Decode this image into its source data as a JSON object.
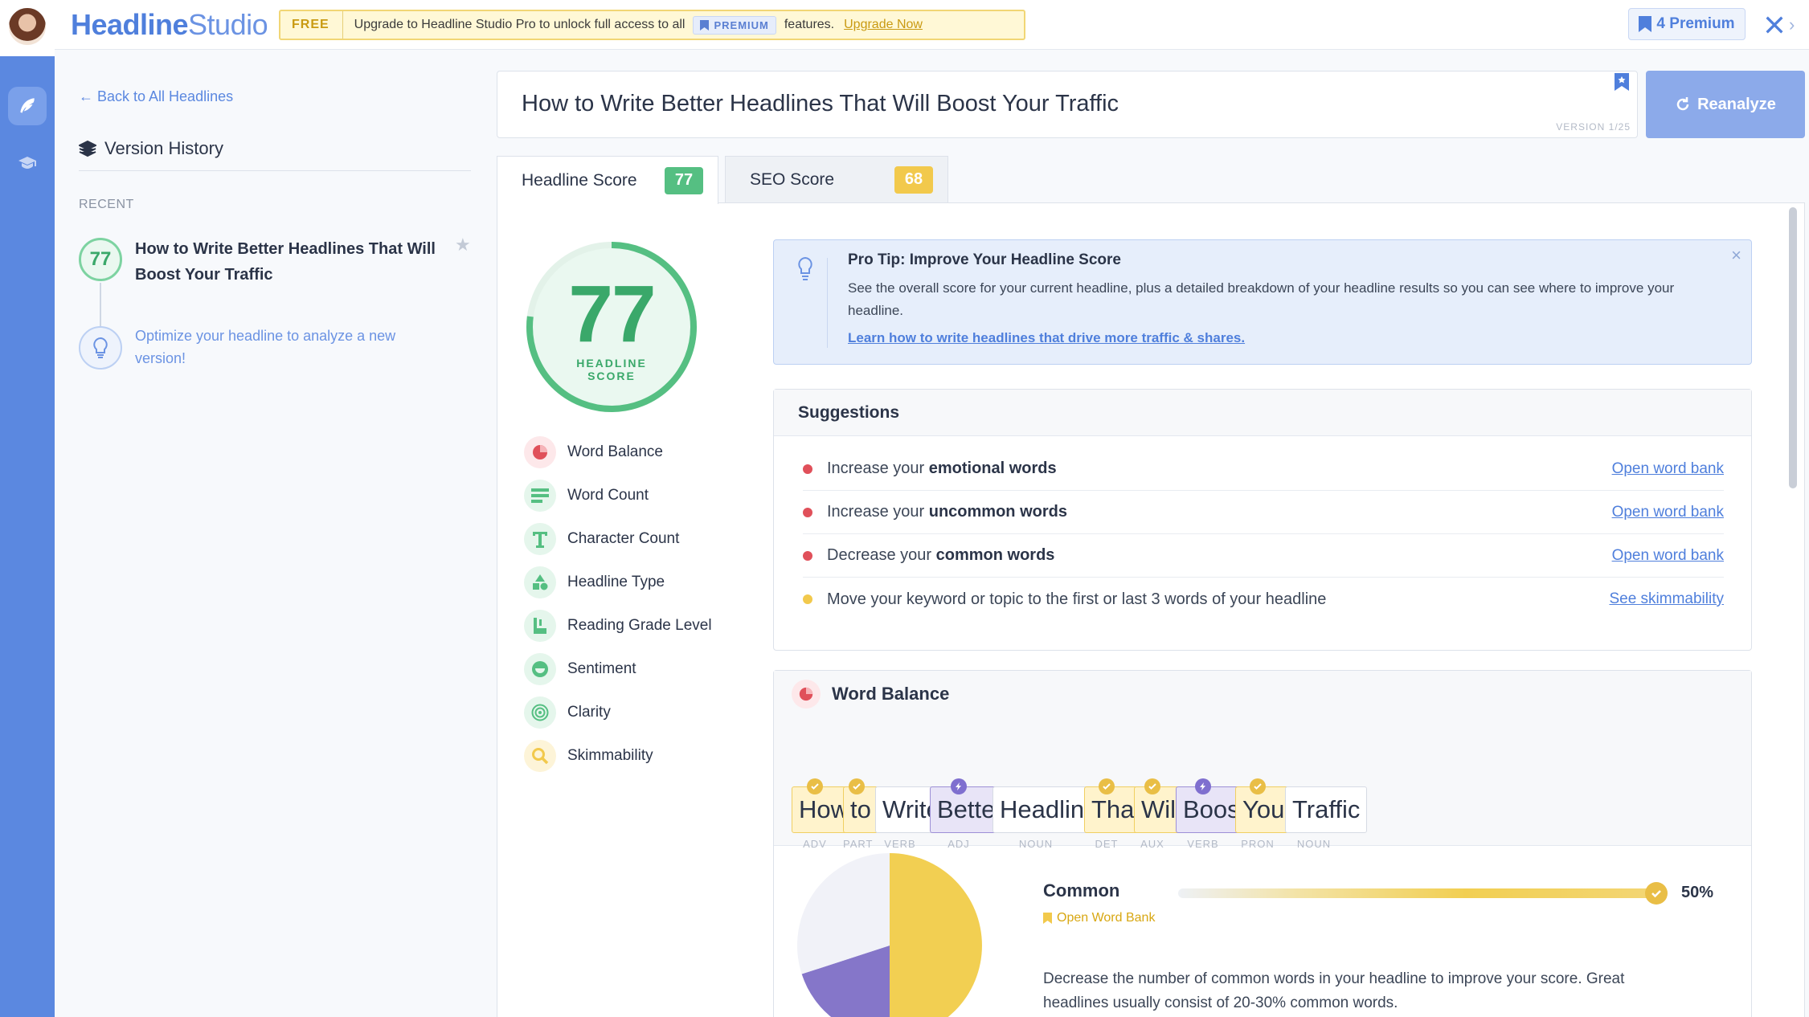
{
  "brand": {
    "name_bold": "Headline",
    "name_light": "Studio"
  },
  "upgrade_banner": {
    "tag": "FREE",
    "message": "Upgrade to Headline Studio Pro to unlock full access to all",
    "premium_pill": "PREMIUM",
    "suffix": "features.",
    "link": "Upgrade Now"
  },
  "premium_button": "4 Premium",
  "sidebar": {
    "back_link": "← Back to All Headlines",
    "title": "Version History",
    "section_label": "RECENT",
    "history": [
      {
        "score": "77",
        "title": "How to Write Better Headlines That Will Boost Your Traffic"
      }
    ],
    "hint": "Optimize your headline to analyze a new version!"
  },
  "headline": {
    "text": "How to Write Better Headlines That Will Boost Your Traffic",
    "version": "VERSION 1/25"
  },
  "reanalyze_label": "Reanalyze",
  "tabs": [
    {
      "label": "Headline Score",
      "score": "77",
      "color": "#55bf82"
    },
    {
      "label": "SEO Score",
      "score": "68",
      "color": "#f2c94c"
    }
  ],
  "score": {
    "value": "77",
    "label_line1": "HEADLINE",
    "label_line2": "SCORE",
    "fraction": 0.77
  },
  "metrics": [
    {
      "label": "Word Balance",
      "icon": "pie-icon"
    },
    {
      "label": "Word Count",
      "icon": "lines-icon"
    },
    {
      "label": "Character Count",
      "icon": "text-icon"
    },
    {
      "label": "Headline Type",
      "icon": "shapes-icon"
    },
    {
      "label": "Reading Grade Level",
      "icon": "book-icon"
    },
    {
      "label": "Sentiment",
      "icon": "smile-icon"
    },
    {
      "label": "Clarity",
      "icon": "target-icon"
    },
    {
      "label": "Skimmability",
      "icon": "magnifier-icon"
    }
  ],
  "pro_tip": {
    "title": "Pro Tip: Improve Your Headline Score",
    "body": "See the overall score for your current headline, plus a detailed breakdown of your headline results so you can see where to improve your headline.",
    "link": "Learn how to write headlines that drive more traffic & shares."
  },
  "suggestions": {
    "title": "Suggestions",
    "items": [
      {
        "prefix": "Increase your ",
        "bold": "emotional words",
        "link": "Open word bank",
        "color": "#e0505a"
      },
      {
        "prefix": "Increase your ",
        "bold": "uncommon words",
        "link": "Open word bank",
        "color": "#e0505a"
      },
      {
        "prefix": "Decrease your ",
        "bold": "common words",
        "link": "Open word bank",
        "color": "#e0505a"
      },
      {
        "prefix": "Move your keyword or topic to the first or last 3 words of your headline",
        "bold": "",
        "link": "See skimmability",
        "color": "#f2c94c"
      }
    ]
  },
  "word_balance": {
    "title": "Word Balance",
    "words": [
      {
        "word": "How",
        "pos": "ADV",
        "type": "common"
      },
      {
        "word": "to",
        "pos": "PART",
        "type": "common"
      },
      {
        "word": "Write",
        "pos": "VERB",
        "type": "none"
      },
      {
        "word": "Better",
        "pos": "ADJ",
        "type": "power"
      },
      {
        "word": "Headlines",
        "pos": "NOUN",
        "type": "none"
      },
      {
        "word": "That",
        "pos": "DET",
        "type": "common"
      },
      {
        "word": "Will",
        "pos": "AUX",
        "type": "common"
      },
      {
        "word": "Boost",
        "pos": "VERB",
        "type": "power"
      },
      {
        "word": "Your",
        "pos": "PRON",
        "type": "common"
      },
      {
        "word": "Traffic",
        "pos": "NOUN",
        "type": "none"
      }
    ],
    "common": {
      "label": "Common",
      "percent": "50%",
      "value": 0.5,
      "link": "Open Word Bank",
      "description": "Decrease the number of common words in your headline to improve your score. Great headlines usually consist of 20-30% common words."
    },
    "pie": [
      {
        "segment": "common",
        "value": 50,
        "color": "#f2cf52"
      },
      {
        "segment": "power",
        "value": 20,
        "color": "#8576c9"
      },
      {
        "segment": "other",
        "value": 30,
        "color": "#f1f2f8"
      }
    ]
  }
}
